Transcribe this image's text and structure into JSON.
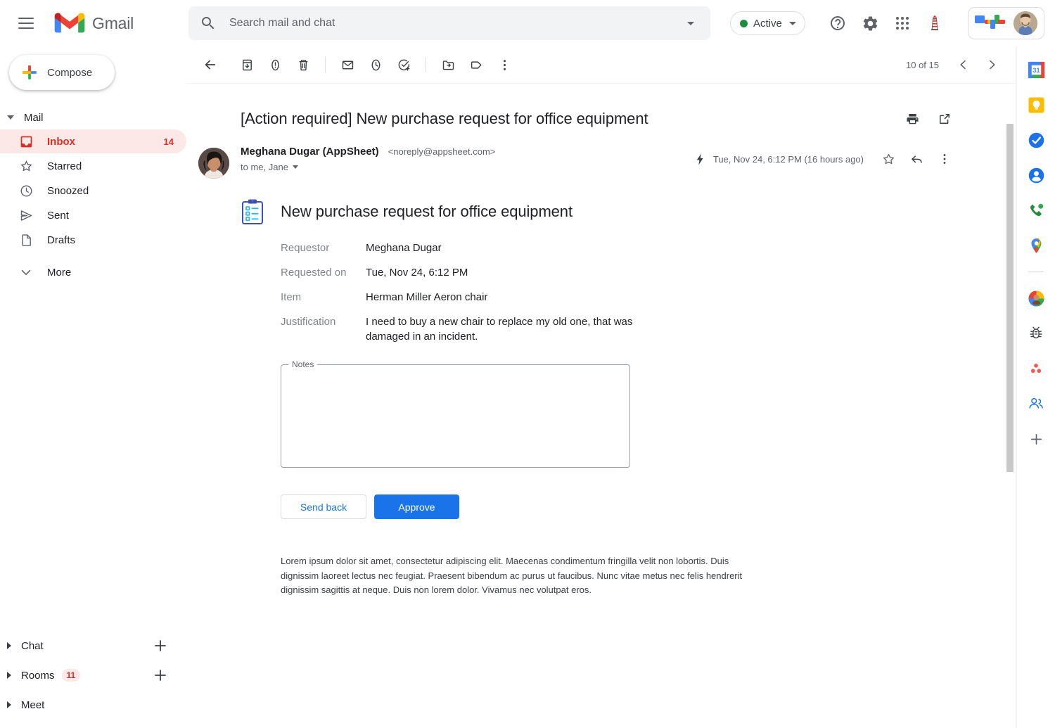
{
  "header": {
    "menu_icon": "hamburger-icon",
    "brand": "Gmail",
    "search": {
      "placeholder": "Search mail and chat",
      "value": "",
      "icon": "search-icon",
      "options_icon": "chevron-down-icon"
    },
    "status": {
      "label": "Active",
      "dot_color": "#1e8e3e",
      "caret_icon": "chevron-down-icon"
    },
    "icons": [
      "help-icon",
      "settings-gear-icon",
      "apps-grid-icon",
      "lighthouse-icon"
    ],
    "account": {
      "blocks_icon": "google-blocks-icon",
      "avatar": "user-avatar"
    }
  },
  "sidebar": {
    "compose": {
      "label": "Compose",
      "icon": "plus-colored-icon"
    },
    "section_label": "Mail",
    "items": [
      {
        "label": "Inbox",
        "icon": "inbox-icon",
        "count": "14",
        "active": true
      },
      {
        "label": "Starred",
        "icon": "star-icon",
        "count": "",
        "active": false
      },
      {
        "label": "Snoozed",
        "icon": "clock-icon",
        "count": "",
        "active": false
      },
      {
        "label": "Sent",
        "icon": "send-icon",
        "count": "",
        "active": false
      },
      {
        "label": "Drafts",
        "icon": "draft-icon",
        "count": "",
        "active": false
      },
      {
        "label": "More",
        "icon": "chevron-down-icon",
        "count": "",
        "active": false
      }
    ],
    "bottom_sections": [
      {
        "label": "Chat",
        "badge": "",
        "add_icon": "plus-icon"
      },
      {
        "label": "Rooms",
        "badge": "11",
        "add_icon": "plus-icon"
      },
      {
        "label": "Meet",
        "badge": "",
        "add_icon": ""
      }
    ]
  },
  "toolbar": {
    "buttons": [
      "back-icon",
      "archive-icon",
      "report-spam-icon",
      "delete-icon",
      "mark-unread-icon",
      "snooze-icon",
      "add-to-tasks-icon",
      "move-to-icon",
      "label-icon",
      "more-options-icon"
    ],
    "pagination": {
      "text": "10 of 15",
      "prev_icon": "chevron-left-icon",
      "next_icon": "chevron-right-icon"
    }
  },
  "email": {
    "subject": "[Action required] New purchase request for office equipment",
    "print_icon": "print-icon",
    "popout_icon": "open-in-new-icon",
    "sender_name": "Meghana Dugar (AppSheet)",
    "sender_email": "<noreply@appsheet.com>",
    "recipients": "to me, Jane",
    "importance_icon": "important-marker-icon",
    "date": "Tue, Nov 24, 6:12 PM (16 hours ago)",
    "star_icon": "star-icon",
    "reply_icon": "reply-icon",
    "more_icon": "more-options-icon",
    "body": {
      "card_icon": "clipboard-checklist-icon",
      "card_title": "New purchase request for office equipment",
      "fields": [
        {
          "key": "Requestor",
          "value": "Meghana Dugar"
        },
        {
          "key": "Requested on",
          "value": "Tue, Nov 24, 6:12 PM"
        },
        {
          "key": "Item",
          "value": "Herman Miller Aeron chair"
        },
        {
          "key": "Justification",
          "value": "I need to buy a new chair to replace my old one, that was damaged in an incident."
        }
      ],
      "notes": {
        "legend": "Notes",
        "value": "",
        "placeholder": ""
      },
      "actions": {
        "secondary": "Send back",
        "primary": "Approve",
        "primary_color": "#1a73e8"
      },
      "footer_text": "Lorem ipsum dolor sit amet, consectetur adipiscing elit. Maecenas condimentum fringilla velit non lobortis. Duis dignissim laoreet lectus nec feugiat. Praesent bibendum ac purus ut faucibus. Nunc vitae metus nec felis hendrerit dignissim sagittis at neque. Duis non lorem dolor. Vivamus nec volutpat eros."
    }
  },
  "right_rail": {
    "apps": [
      "google-calendar-icon",
      "google-keep-icon",
      "google-tasks-icon",
      "google-contacts-icon",
      "google-voice-icon",
      "google-maps-icon"
    ],
    "addons": [
      "avatar-addon-icon",
      "bug-addon-icon",
      "dots-addon-icon",
      "people-addon-icon"
    ],
    "add_button": "plus-icon"
  }
}
